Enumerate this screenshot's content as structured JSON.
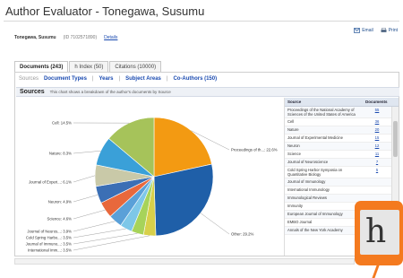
{
  "window": {
    "title": "Author Evaluator - Tonegawa, Susumu"
  },
  "actions": {
    "email": "Email",
    "print": "Print"
  },
  "author": {
    "name": "Tonegawa, Susumu",
    "id": "(ID 7102571890)",
    "details": "Details"
  },
  "tabs": [
    {
      "label": "Documents (243)",
      "active": true
    },
    {
      "label": "h Index (50)",
      "active": false
    },
    {
      "label": "Citations (10000)",
      "active": false
    }
  ],
  "subnav": {
    "label": "Sources",
    "items": [
      "Document Types",
      "Years",
      "Subject Areas",
      "Co-Authors (150)"
    ]
  },
  "section": {
    "title": "Sources",
    "description": "This chart shows a breakdown of the author's documents by Source"
  },
  "chart_data": {
    "type": "pie",
    "slices": [
      {
        "label": "Proceedings of th...: 22.6%",
        "value": 22.6,
        "color": "#f39a12"
      },
      {
        "label": "Other: 29.2%",
        "value": 29.2,
        "color": "#1f5fa8"
      },
      {
        "label": "International Imm...: 3.5%",
        "value": 3.5,
        "color": "#d8d04a"
      },
      {
        "label": "Journal of Immuno...: 3.5%",
        "value": 3.5,
        "color": "#a7d35a"
      },
      {
        "label": "Cold Spring Harbo...: 3.5%",
        "value": 3.5,
        "color": "#7ec7e8"
      },
      {
        "label": "Journal of Neuros...: 3.9%",
        "value": 3.9,
        "color": "#5aa0d8"
      },
      {
        "label": "Science: 4.6%",
        "value": 4.6,
        "color": "#e8683c"
      },
      {
        "label": "Neuron: 4.9%",
        "value": 4.9,
        "color": "#3b6fb5"
      },
      {
        "label": "Journal of Experi...: 6.1%",
        "value": 6.1,
        "color": "#c9c9a8"
      },
      {
        "label": "Nature: 8.3%",
        "value": 8.3,
        "color": "#3aa0d8"
      },
      {
        "label": "Cell: 14.5%",
        "value": 14.5,
        "color": "#a6c35a"
      }
    ]
  },
  "table": {
    "headers": [
      "Source",
      "Documents"
    ],
    "rows": [
      {
        "source": "Proceedings of the National Academy of Sciences of the United States of America",
        "count": "55"
      },
      {
        "source": "Cell",
        "count": "36"
      },
      {
        "source": "Nature",
        "count": "20"
      },
      {
        "source": "Journal of Experimental Medicine",
        "count": "15"
      },
      {
        "source": "Neuron",
        "count": "12"
      },
      {
        "source": "Science",
        "count": "11"
      },
      {
        "source": "Journal of Neuroscience",
        "count": "7"
      },
      {
        "source": "Cold Spring Harbor Symposia on Quantitative Biology",
        "count": "5"
      },
      {
        "source": "Journal of Immunology",
        "count": ""
      },
      {
        "source": "International Immunology",
        "count": ""
      },
      {
        "source": "Immunological Reviews",
        "count": ""
      },
      {
        "source": "Immunity",
        "count": ""
      },
      {
        "source": "European Journal of Immunology",
        "count": ""
      },
      {
        "source": "EMBO Journal",
        "count": ""
      },
      {
        "source": "Annals of the New York Academy",
        "count": ""
      }
    ]
  },
  "magnifier": {
    "glyph": "h"
  }
}
